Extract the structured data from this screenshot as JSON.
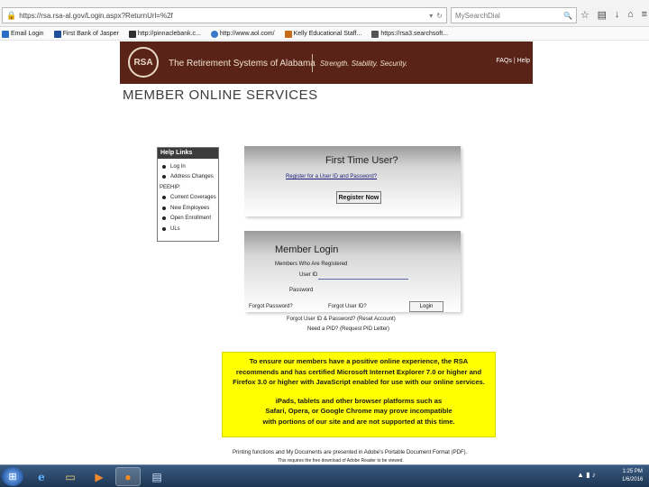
{
  "browser": {
    "url": "https://rsa.rsa-al.gov/Login.aspx?ReturnUrl=%2f",
    "search_placeholder": "MySearchDial",
    "icons": [
      "star-icon",
      "reading-list-icon",
      "download-icon",
      "home-icon",
      "menu-icon"
    ]
  },
  "bookmarks": [
    {
      "label": "Email Login",
      "color": "#2b6cc4"
    },
    {
      "label": "First Bank of Jasper",
      "color": "#1e4f9c"
    },
    {
      "label": "http://pinnaclebank.c...",
      "color": "#2f2f2f"
    },
    {
      "label": "http://www.aol.com/",
      "color": "#3a78c8"
    },
    {
      "label": "Kelly Educational Staff...",
      "color": "#c76a1a"
    },
    {
      "label": "https://rsa3.searchsoft...",
      "color": "#555555"
    }
  ],
  "header": {
    "logo_text": "RSA",
    "org_name": "The Retirement Systems of Alabama",
    "tagline": "Strength. Stability. Security.",
    "links": "FAQs | Help"
  },
  "page": {
    "heading": "MEMBER ONLINE SERVICES"
  },
  "help_links": {
    "title": "Help Links",
    "items": [
      {
        "label": "Log In",
        "bullet": true
      },
      {
        "label": "Address Changes",
        "bullet": true
      },
      {
        "label": "PEEHIP:",
        "bullet": false
      },
      {
        "label": "Current Coverages",
        "bullet": true
      },
      {
        "label": "New Employees",
        "bullet": true
      },
      {
        "label": "Open Enrollment",
        "bullet": true
      },
      {
        "label": "ULs",
        "bullet": true
      }
    ]
  },
  "first_time": {
    "title": "First Time User?",
    "link": "Register for a User ID and Password?",
    "button": "Register Now"
  },
  "login": {
    "title": "Member Login",
    "subtitle": "Members Who Are Registered",
    "userid_label": "User ID",
    "password_label": "Password",
    "forgot_password": "Forgot Password?",
    "forgot_userid": "Forgot User ID?",
    "button": "Login",
    "forgot_both": "Forgot User ID & Password? (Reset Account)",
    "need_pid": "Need a PID? (Request PID Letter)"
  },
  "notice": {
    "lines_1": [
      "To ensure our members have a positive online experience, the RSA",
      "recommends and has certified Microsoft Internet Explorer 7.0 or higher and",
      "Firefox 3.0 or higher with JavaScript enabled for use with our online services."
    ],
    "lines_2": [
      "iPads, tablets and other browser platforms such as",
      "Safari, Opera, or Google Chrome may prove incompatible",
      "with portions of our site and are not supported at this time."
    ],
    "bg_color": "#ffff00"
  },
  "footer": {
    "pdf_note": "Printing functions and My Documents are presented in Adobe's Portable Document Format (PDF).",
    "pdf_note2": "This requires the free download of Adobe Reader to be viewed."
  },
  "taskbar": {
    "time": "1:25 PM",
    "date": "1/6/2016",
    "apps": [
      "start-orb-icon",
      "internet-explorer-icon",
      "file-explorer-icon",
      "media-player-icon",
      "firefox-icon",
      "documents-icon"
    ]
  }
}
